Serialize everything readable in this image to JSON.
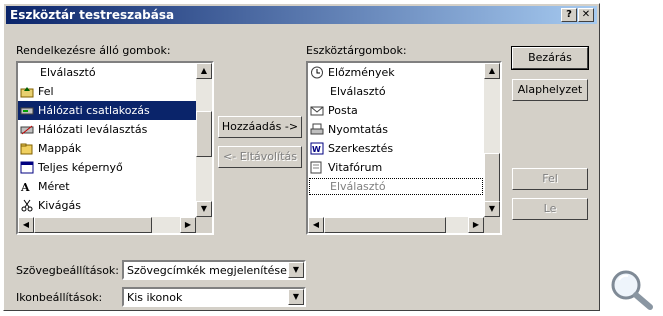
{
  "window": {
    "title": "Eszköztár testreszabása",
    "help_label": "?",
    "close_label": "✕"
  },
  "available": {
    "label": "Rendelkezésre álló gombok:",
    "items": [
      {
        "label": "Elválasztó",
        "icon": "separator-icon"
      },
      {
        "label": "Fel",
        "icon": "up-folder-icon"
      },
      {
        "label": "Hálózati csatlakozás",
        "icon": "map-network-drive-icon",
        "selected": true
      },
      {
        "label": "Hálózati leválasztás",
        "icon": "disconnect-network-drive-icon"
      },
      {
        "label": "Mappák",
        "icon": "folders-icon"
      },
      {
        "label": "Teljes képernyő",
        "icon": "full-screen-icon"
      },
      {
        "label": "Méret",
        "icon": "size-icon"
      },
      {
        "label": "Kivágás",
        "icon": "cut-icon"
      }
    ]
  },
  "current": {
    "label": "Eszköztárgombok:",
    "items": [
      {
        "label": "Előzmények",
        "icon": "history-icon"
      },
      {
        "label": "Elválasztó",
        "icon": "separator-icon"
      },
      {
        "label": "Posta",
        "icon": "mail-icon"
      },
      {
        "label": "Nyomtatás",
        "icon": "print-icon"
      },
      {
        "label": "Szerkesztés",
        "icon": "edit-icon"
      },
      {
        "label": "Vitafórum",
        "icon": "discuss-icon"
      },
      {
        "label": "Elválasztó",
        "icon": "separator-icon",
        "focused": true
      }
    ]
  },
  "buttons": {
    "add": "Hozzáadás ->",
    "remove": "<- Eltávolítás",
    "close": "Bezárás",
    "reset": "Alaphelyzet",
    "move_up": "Fel",
    "move_down": "Le"
  },
  "text_options": {
    "label": "Szövegbeállítások:",
    "value": "Szövegcímkék megjelenítése"
  },
  "icon_options": {
    "label": "Ikonbeállítások:",
    "value": "Kis ikonok"
  },
  "colors": {
    "title_start": "#0a246a",
    "title_end": "#a6caf0",
    "selection": "#0a246a",
    "face": "#d4d0c8"
  }
}
